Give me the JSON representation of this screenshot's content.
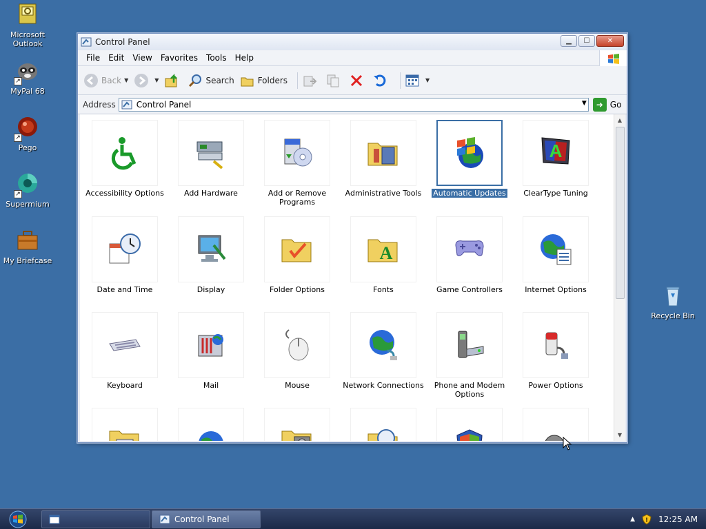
{
  "desktop": {
    "icons": [
      {
        "label": "Microsoft Outlook"
      },
      {
        "label": "MyPal 68"
      },
      {
        "label": "Pego"
      },
      {
        "label": "Supermium"
      },
      {
        "label": "My Briefcase"
      },
      {
        "label": "Recycle Bin"
      }
    ]
  },
  "window": {
    "title": "Control Panel",
    "menu": [
      "File",
      "Edit",
      "View",
      "Favorites",
      "Tools",
      "Help"
    ],
    "toolbar": {
      "back": "Back",
      "search": "Search",
      "folders": "Folders"
    },
    "address": {
      "label": "Address",
      "value": "Control Panel",
      "go": "Go"
    },
    "items": [
      "Accessibility Options",
      "Add Hardware",
      "Add or Remove Programs",
      "Administrative Tools",
      "Automatic Updates",
      "ClearType Tuning",
      "Date and Time",
      "Display",
      "Folder Options",
      "Fonts",
      "Game Controllers",
      "Internet Options",
      "Keyboard",
      "Mail",
      "Mouse",
      "Network Connections",
      "Phone and Modem Options",
      "Power Options"
    ],
    "selected_item": "Automatic Updates"
  },
  "taskbar": {
    "buttons": [
      "",
      "Control Panel"
    ],
    "clock": "12:25 AM"
  },
  "colors": {
    "desktop": "#3b6ea5",
    "selection": "#3a6ea5"
  }
}
